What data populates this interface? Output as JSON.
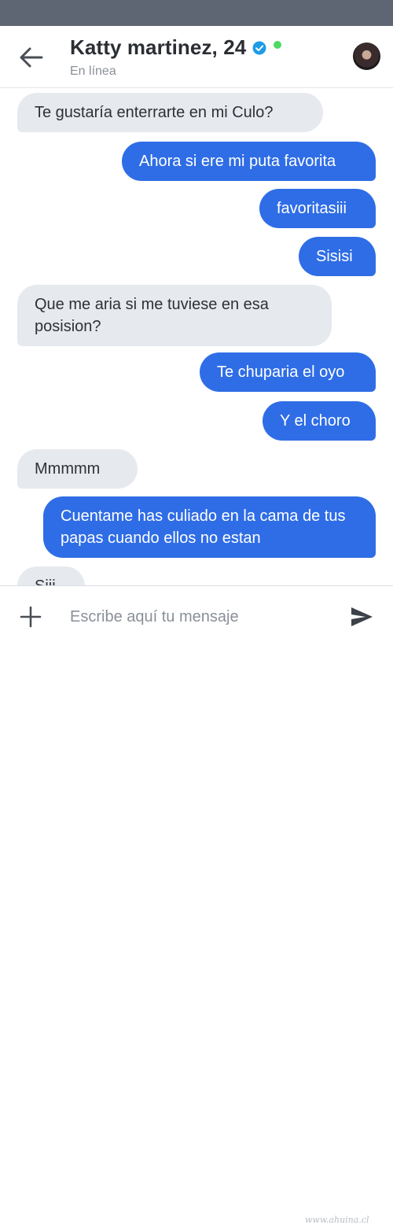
{
  "header": {
    "title": "Katty martinez, 24",
    "status": "En línea"
  },
  "messages": [
    {
      "side": "in",
      "text": "Te gustaría enterrarte en mi Culo?"
    },
    {
      "side": "out",
      "text": "Ahora si ere mi puta favorita"
    },
    {
      "side": "out",
      "text": "favoritasiii"
    },
    {
      "side": "out",
      "text": "Sisisi"
    },
    {
      "side": "in",
      "text": "Que me aria si me tuviese en esa posision?"
    },
    {
      "side": "out",
      "text": "Te chuparia el oyo"
    },
    {
      "side": "out",
      "text": "Y el choro"
    },
    {
      "side": "in",
      "text": "Mmmmm"
    },
    {
      "side": "out",
      "text": "Cuentame has culiado en la cama de tus papas cuando ellos no estan"
    },
    {
      "side": "in",
      "text": "Siii"
    }
  ],
  "composer": {
    "placeholder": "Escribe aquí tu mensaje"
  },
  "watermark": "www.ahuina.cl",
  "colors": {
    "status_bar": "#5f6673",
    "outgoing_bubble": "#2f6de6",
    "incoming_bubble": "#e6e9ee",
    "online": "#4cd964",
    "verified": "#1e9be8"
  }
}
